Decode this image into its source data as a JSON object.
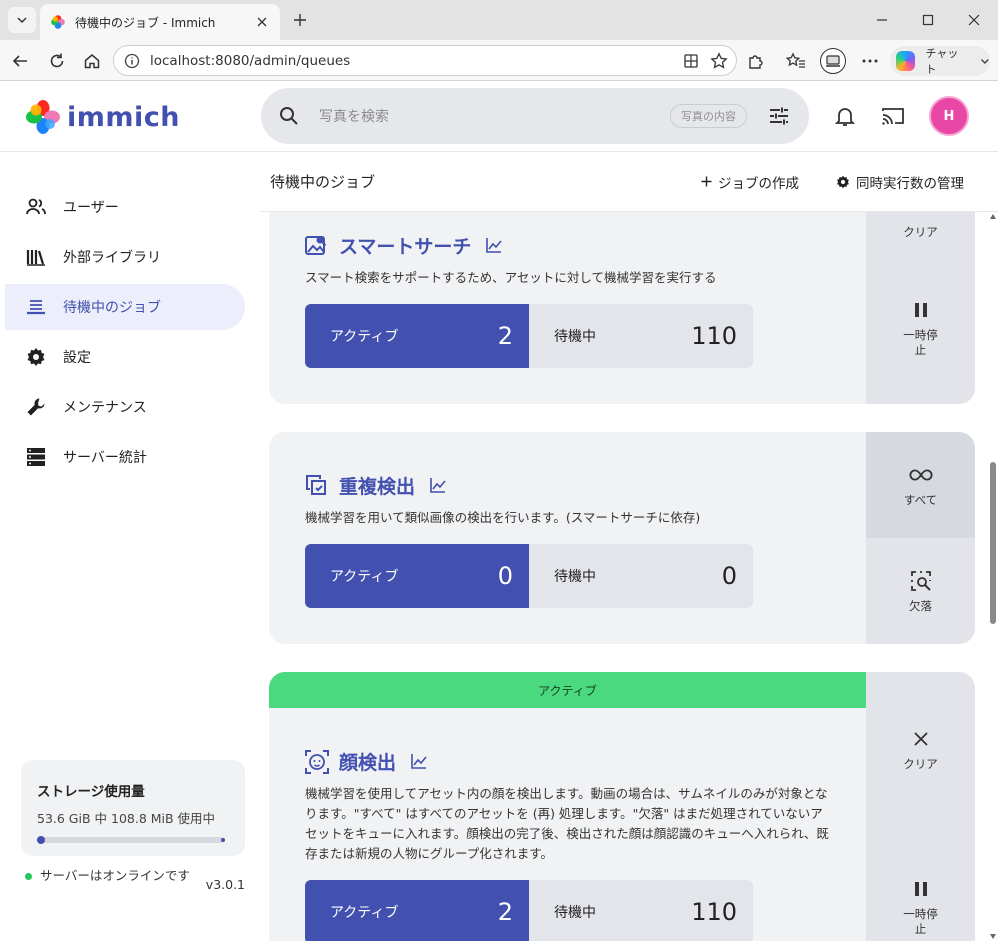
{
  "browser": {
    "tab_title": "待機中のジョブ - Immich",
    "url": "localhost:8080/admin/queues",
    "chat_label": "チャット"
  },
  "header": {
    "logo_text": "immich",
    "search_placeholder": "写真を検索",
    "search_chip": "写真の内容",
    "avatar_initial": "H"
  },
  "sidebar": {
    "items": [
      {
        "label": "ユーザー",
        "icon": "users-icon"
      },
      {
        "label": "外部ライブラリ",
        "icon": "library-icon"
      },
      {
        "label": "待機中のジョブ",
        "icon": "queue-icon",
        "active": true
      },
      {
        "label": "設定",
        "icon": "gear-icon"
      },
      {
        "label": "メンテナンス",
        "icon": "wrench-icon"
      },
      {
        "label": "サーバー統計",
        "icon": "server-icon"
      }
    ],
    "storage": {
      "title": "ストレージ使用量",
      "usage": "53.6 GiB 中 108.8 MiB 使用中",
      "used_fraction": 0.002
    },
    "server": {
      "status": "サーバーはオンラインです",
      "version": "v3.0.1"
    }
  },
  "page": {
    "title": "待機中のジョブ",
    "create_job": "ジョブの作成",
    "manage_concurrency": "同時実行数の管理"
  },
  "jobs": [
    {
      "title": "スマートサーチ",
      "description": "スマート検索をサポートするため、アセットに対して機械学習を実行する",
      "active_label": "アクティブ",
      "active_count": "2",
      "waiting_label": "待機中",
      "waiting_count": "110",
      "actions": [
        {
          "label": "クリア",
          "icon": "clear-icon"
        },
        {
          "label": "一時停止",
          "icon": "pause-icon"
        }
      ]
    },
    {
      "title": "重複検出",
      "description": "機械学習を用いて類似画像の検出を行います。(スマートサーチに依存)",
      "active_label": "アクティブ",
      "active_count": "0",
      "waiting_label": "待機中",
      "waiting_count": "0",
      "actions": [
        {
          "label": "すべて",
          "icon": "infinity-icon"
        },
        {
          "label": "欠落",
          "icon": "missing-icon"
        }
      ]
    },
    {
      "status_banner": "アクティブ",
      "title": "顔検出",
      "description": "機械学習を使用してアセット内の顔を検出します。動画の場合は、サムネイルのみが対象となります。\"すべて\" はすべてのアセットを (再) 処理します。\"欠落\" はまだ処理されていないアセットをキューに入れます。顔検出の完了後、検出された顔は顔認識のキューへ入れられ、既存または新規の人物にグループ化されます。",
      "active_label": "アクティブ",
      "active_count": "2",
      "waiting_label": "待機中",
      "waiting_count": "110",
      "actions": [
        {
          "label": "クリア",
          "icon": "close-icon"
        },
        {
          "label": "一時停止",
          "icon": "pause-icon"
        }
      ]
    }
  ]
}
